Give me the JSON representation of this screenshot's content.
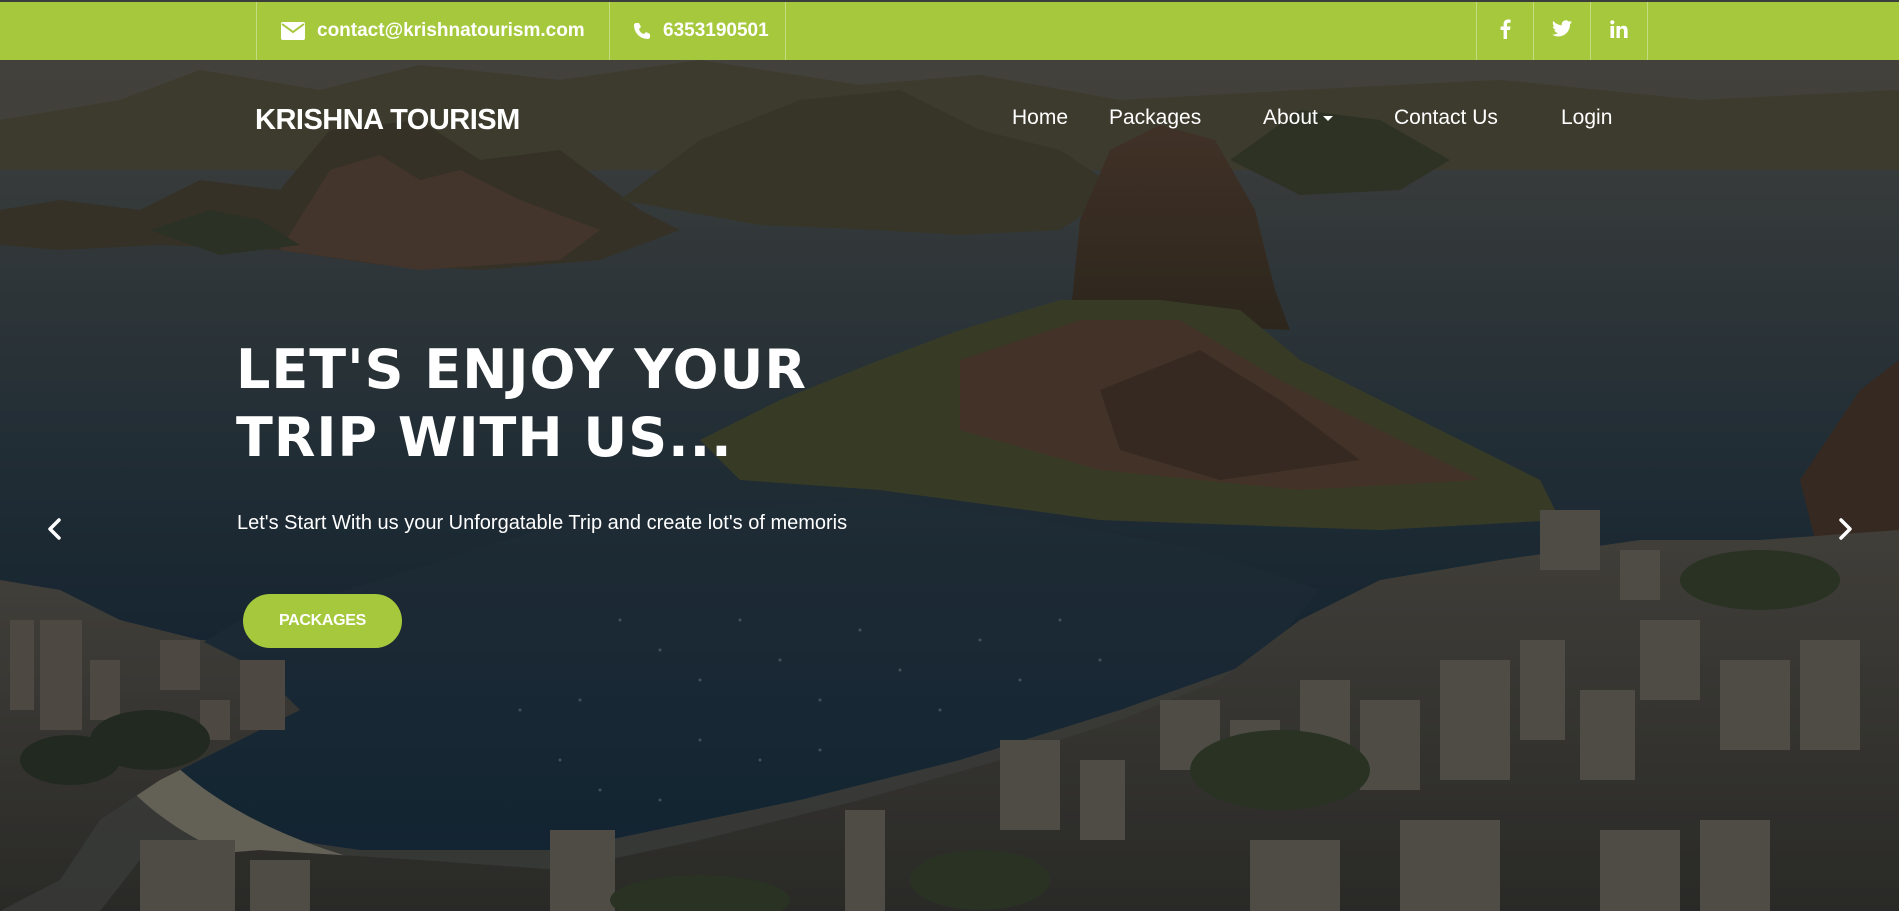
{
  "topbar": {
    "email": "contact@krishnatourism.com",
    "phone": "6353190501",
    "social": [
      "f",
      "t",
      "in"
    ]
  },
  "nav": {
    "brand": "KRISHNA TOURISM",
    "items": [
      "Home",
      "Packages",
      "About",
      "Contact Us",
      "Login"
    ]
  },
  "hero": {
    "headline_line1": "LET'S ENJOY YOUR",
    "headline_line2": "TRIP WITH US...",
    "subtitle": "Let's Start With us your Unforgatable Trip and create lot's of memoris",
    "cta": "PACKAGES"
  },
  "colors": {
    "accent": "#a5c83c",
    "text": "#ffffff"
  },
  "icons": {
    "email": "envelope-icon",
    "phone": "phone-icon",
    "facebook": "facebook-icon",
    "twitter": "twitter-icon",
    "linkedin": "linkedin-icon",
    "prev": "chevron-left-icon",
    "next": "chevron-right-icon",
    "about_dropdown": "caret-down-icon"
  }
}
